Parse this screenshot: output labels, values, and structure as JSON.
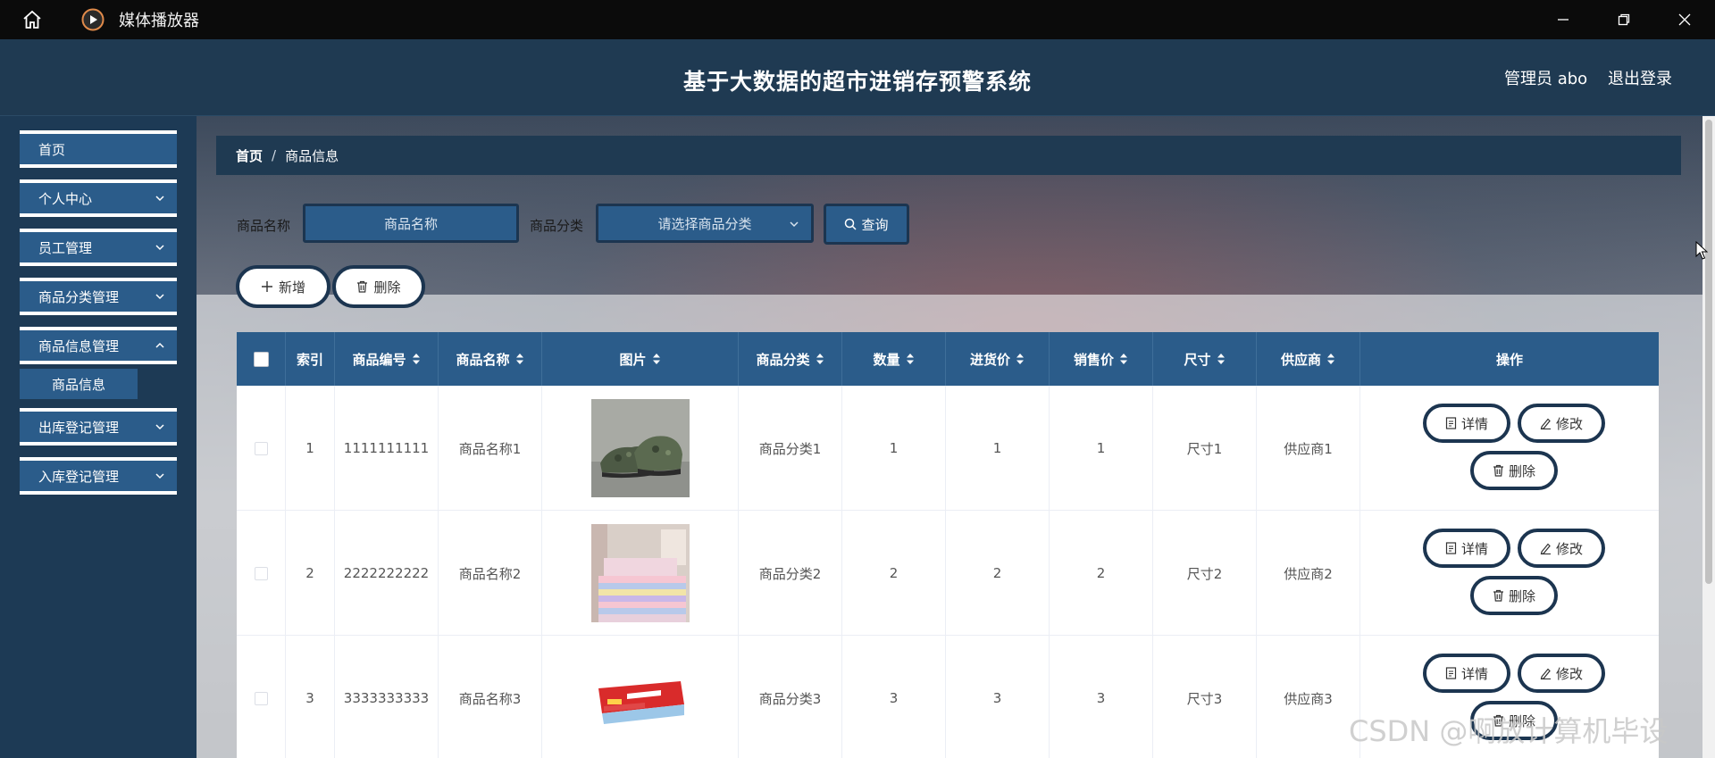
{
  "window": {
    "title": "媒体播放器"
  },
  "header": {
    "title": "基于大数据的超市进销存预警系统",
    "user": "管理员 abo",
    "logout": "退出登录"
  },
  "sidebar": {
    "items": [
      {
        "label": "首页"
      },
      {
        "label": "个人中心"
      },
      {
        "label": "员工管理"
      },
      {
        "label": "商品分类管理"
      },
      {
        "label": "商品信息管理"
      },
      {
        "label": "出库登记管理"
      },
      {
        "label": "入库登记管理"
      }
    ],
    "sub_item": "商品信息"
  },
  "breadcrumb": {
    "home": "首页",
    "current": "商品信息"
  },
  "search": {
    "name_label": "商品名称",
    "name_placeholder": "商品名称",
    "category_label": "商品分类",
    "category_placeholder": "请选择商品分类",
    "query_label": "查询"
  },
  "actions": {
    "add": "新增",
    "delete": "删除"
  },
  "table": {
    "headers": [
      "索引",
      "商品编号",
      "商品名称",
      "图片",
      "商品分类",
      "数量",
      "进货价",
      "销售价",
      "尺寸",
      "供应商",
      "操作"
    ],
    "rows": [
      {
        "index": "1",
        "code": "1111111111",
        "name": "商品名称1",
        "category": "商品分类1",
        "qty": "1",
        "cost": "1",
        "price": "1",
        "size": "尺寸1",
        "supplier": "供应商1"
      },
      {
        "index": "2",
        "code": "2222222222",
        "name": "商品名称2",
        "category": "商品分类2",
        "qty": "2",
        "cost": "2",
        "price": "2",
        "size": "尺寸2",
        "supplier": "供应商2"
      },
      {
        "index": "3",
        "code": "3333333333",
        "name": "商品名称3",
        "category": "商品分类3",
        "qty": "3",
        "cost": "3",
        "price": "3",
        "size": "尺寸3",
        "supplier": "供应商3"
      }
    ],
    "row_actions": {
      "detail": "详情",
      "edit": "修改",
      "delete": "删除"
    }
  },
  "watermark": "CSDN @啊放计算机毕设",
  "colors": {
    "primary": "#2b5c8a",
    "dark": "#1c3550",
    "header": "#1f3a52"
  }
}
